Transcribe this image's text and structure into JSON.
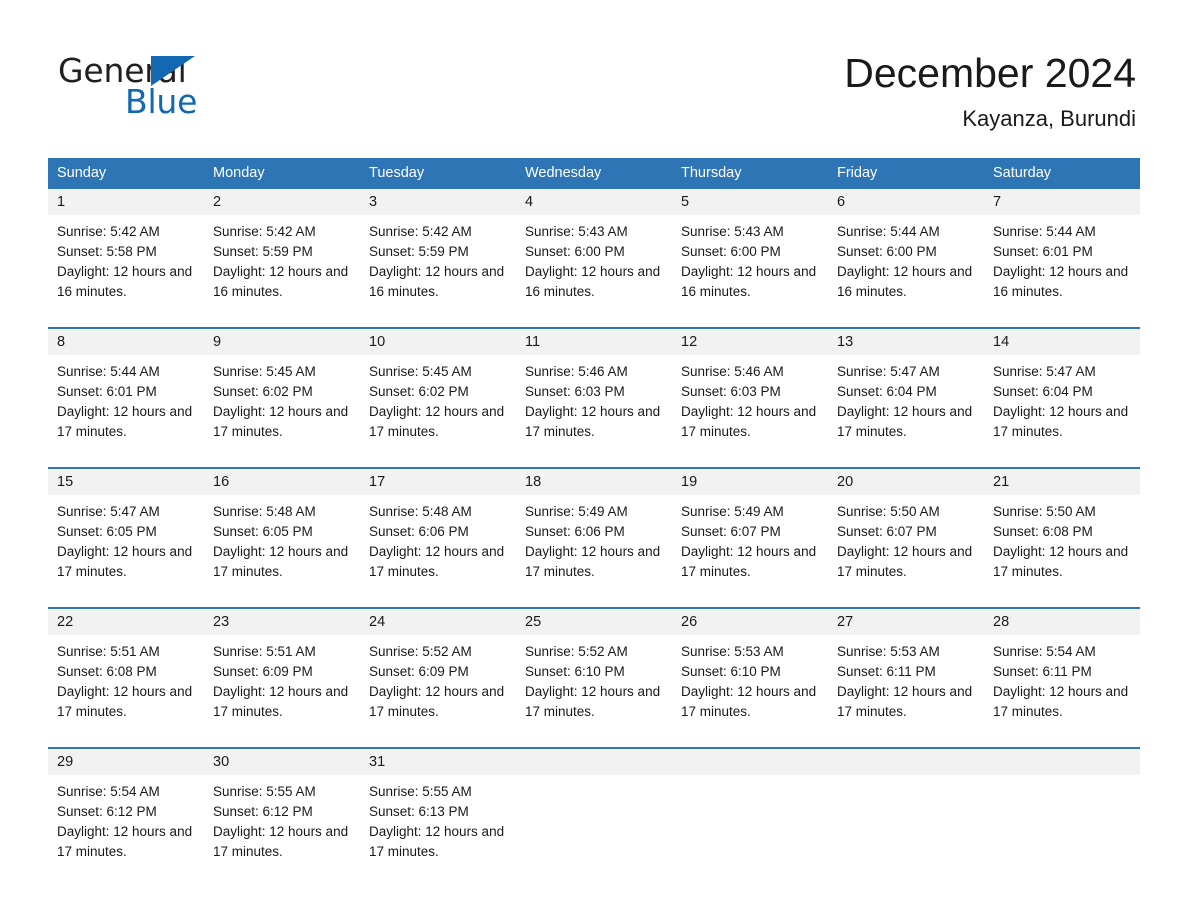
{
  "brand": {
    "name_part1": "General",
    "name_part2": "Blue",
    "accent_color": "#1268b3",
    "triangle_icon": "triangle-icon"
  },
  "header": {
    "title": "December 2024",
    "location": "Kayanza, Burundi"
  },
  "calendar": {
    "header_color": "#2e75b6",
    "day_band_color": "#f2f2f2",
    "day_names": [
      "Sunday",
      "Monday",
      "Tuesday",
      "Wednesday",
      "Thursday",
      "Friday",
      "Saturday"
    ],
    "weeks": [
      [
        {
          "day": "1",
          "sunrise": "Sunrise: 5:42 AM",
          "sunset": "Sunset: 5:58 PM",
          "daylight": "Daylight: 12 hours and 16 minutes."
        },
        {
          "day": "2",
          "sunrise": "Sunrise: 5:42 AM",
          "sunset": "Sunset: 5:59 PM",
          "daylight": "Daylight: 12 hours and 16 minutes."
        },
        {
          "day": "3",
          "sunrise": "Sunrise: 5:42 AM",
          "sunset": "Sunset: 5:59 PM",
          "daylight": "Daylight: 12 hours and 16 minutes."
        },
        {
          "day": "4",
          "sunrise": "Sunrise: 5:43 AM",
          "sunset": "Sunset: 6:00 PM",
          "daylight": "Daylight: 12 hours and 16 minutes."
        },
        {
          "day": "5",
          "sunrise": "Sunrise: 5:43 AM",
          "sunset": "Sunset: 6:00 PM",
          "daylight": "Daylight: 12 hours and 16 minutes."
        },
        {
          "day": "6",
          "sunrise": "Sunrise: 5:44 AM",
          "sunset": "Sunset: 6:00 PM",
          "daylight": "Daylight: 12 hours and 16 minutes."
        },
        {
          "day": "7",
          "sunrise": "Sunrise: 5:44 AM",
          "sunset": "Sunset: 6:01 PM",
          "daylight": "Daylight: 12 hours and 16 minutes."
        }
      ],
      [
        {
          "day": "8",
          "sunrise": "Sunrise: 5:44 AM",
          "sunset": "Sunset: 6:01 PM",
          "daylight": "Daylight: 12 hours and 17 minutes."
        },
        {
          "day": "9",
          "sunrise": "Sunrise: 5:45 AM",
          "sunset": "Sunset: 6:02 PM",
          "daylight": "Daylight: 12 hours and 17 minutes."
        },
        {
          "day": "10",
          "sunrise": "Sunrise: 5:45 AM",
          "sunset": "Sunset: 6:02 PM",
          "daylight": "Daylight: 12 hours and 17 minutes."
        },
        {
          "day": "11",
          "sunrise": "Sunrise: 5:46 AM",
          "sunset": "Sunset: 6:03 PM",
          "daylight": "Daylight: 12 hours and 17 minutes."
        },
        {
          "day": "12",
          "sunrise": "Sunrise: 5:46 AM",
          "sunset": "Sunset: 6:03 PM",
          "daylight": "Daylight: 12 hours and 17 minutes."
        },
        {
          "day": "13",
          "sunrise": "Sunrise: 5:47 AM",
          "sunset": "Sunset: 6:04 PM",
          "daylight": "Daylight: 12 hours and 17 minutes."
        },
        {
          "day": "14",
          "sunrise": "Sunrise: 5:47 AM",
          "sunset": "Sunset: 6:04 PM",
          "daylight": "Daylight: 12 hours and 17 minutes."
        }
      ],
      [
        {
          "day": "15",
          "sunrise": "Sunrise: 5:47 AM",
          "sunset": "Sunset: 6:05 PM",
          "daylight": "Daylight: 12 hours and 17 minutes."
        },
        {
          "day": "16",
          "sunrise": "Sunrise: 5:48 AM",
          "sunset": "Sunset: 6:05 PM",
          "daylight": "Daylight: 12 hours and 17 minutes."
        },
        {
          "day": "17",
          "sunrise": "Sunrise: 5:48 AM",
          "sunset": "Sunset: 6:06 PM",
          "daylight": "Daylight: 12 hours and 17 minutes."
        },
        {
          "day": "18",
          "sunrise": "Sunrise: 5:49 AM",
          "sunset": "Sunset: 6:06 PM",
          "daylight": "Daylight: 12 hours and 17 minutes."
        },
        {
          "day": "19",
          "sunrise": "Sunrise: 5:49 AM",
          "sunset": "Sunset: 6:07 PM",
          "daylight": "Daylight: 12 hours and 17 minutes."
        },
        {
          "day": "20",
          "sunrise": "Sunrise: 5:50 AM",
          "sunset": "Sunset: 6:07 PM",
          "daylight": "Daylight: 12 hours and 17 minutes."
        },
        {
          "day": "21",
          "sunrise": "Sunrise: 5:50 AM",
          "sunset": "Sunset: 6:08 PM",
          "daylight": "Daylight: 12 hours and 17 minutes."
        }
      ],
      [
        {
          "day": "22",
          "sunrise": "Sunrise: 5:51 AM",
          "sunset": "Sunset: 6:08 PM",
          "daylight": "Daylight: 12 hours and 17 minutes."
        },
        {
          "day": "23",
          "sunrise": "Sunrise: 5:51 AM",
          "sunset": "Sunset: 6:09 PM",
          "daylight": "Daylight: 12 hours and 17 minutes."
        },
        {
          "day": "24",
          "sunrise": "Sunrise: 5:52 AM",
          "sunset": "Sunset: 6:09 PM",
          "daylight": "Daylight: 12 hours and 17 minutes."
        },
        {
          "day": "25",
          "sunrise": "Sunrise: 5:52 AM",
          "sunset": "Sunset: 6:10 PM",
          "daylight": "Daylight: 12 hours and 17 minutes."
        },
        {
          "day": "26",
          "sunrise": "Sunrise: 5:53 AM",
          "sunset": "Sunset: 6:10 PM",
          "daylight": "Daylight: 12 hours and 17 minutes."
        },
        {
          "day": "27",
          "sunrise": "Sunrise: 5:53 AM",
          "sunset": "Sunset: 6:11 PM",
          "daylight": "Daylight: 12 hours and 17 minutes."
        },
        {
          "day": "28",
          "sunrise": "Sunrise: 5:54 AM",
          "sunset": "Sunset: 6:11 PM",
          "daylight": "Daylight: 12 hours and 17 minutes."
        }
      ],
      [
        {
          "day": "29",
          "sunrise": "Sunrise: 5:54 AM",
          "sunset": "Sunset: 6:12 PM",
          "daylight": "Daylight: 12 hours and 17 minutes."
        },
        {
          "day": "30",
          "sunrise": "Sunrise: 5:55 AM",
          "sunset": "Sunset: 6:12 PM",
          "daylight": "Daylight: 12 hours and 17 minutes."
        },
        {
          "day": "31",
          "sunrise": "Sunrise: 5:55 AM",
          "sunset": "Sunset: 6:13 PM",
          "daylight": "Daylight: 12 hours and 17 minutes."
        },
        {
          "day": "",
          "sunrise": "",
          "sunset": "",
          "daylight": ""
        },
        {
          "day": "",
          "sunrise": "",
          "sunset": "",
          "daylight": ""
        },
        {
          "day": "",
          "sunrise": "",
          "sunset": "",
          "daylight": ""
        },
        {
          "day": "",
          "sunrise": "",
          "sunset": "",
          "daylight": ""
        }
      ]
    ]
  }
}
